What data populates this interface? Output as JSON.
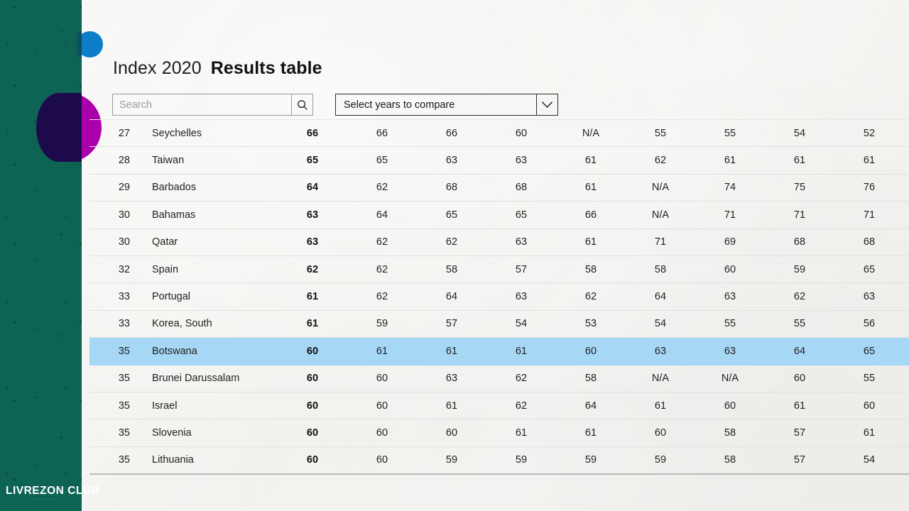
{
  "brand": {
    "logo_text": "LIVREZON CLUB",
    "logo_subtitle": "··························",
    "sidebar_color": "#0d6354",
    "circle_blue": "#0d7ec9",
    "circle_magenta": "#aa00ab",
    "circle_dark": "#1c0a4c"
  },
  "header": {
    "index_label": "Index 2020",
    "title": "Results table"
  },
  "search": {
    "value": "",
    "placeholder": "Search",
    "icon": "search-icon"
  },
  "year_select": {
    "label": "Select years to compare",
    "icon": "chevron-down-icon"
  },
  "table": {
    "highlight_color": "#a6d7f5",
    "highlighted_row_name": "Botswana",
    "rows": [
      {
        "rank": "27",
        "country": "Seychelles",
        "score": "66",
        "years": [
          "66",
          "66",
          "60",
          "N/A",
          "55",
          "55",
          "54",
          "52"
        ],
        "highlight": false
      },
      {
        "rank": "28",
        "country": "Taiwan",
        "score": "65",
        "years": [
          "65",
          "63",
          "63",
          "61",
          "62",
          "61",
          "61",
          "61"
        ],
        "highlight": false
      },
      {
        "rank": "29",
        "country": "Barbados",
        "score": "64",
        "years": [
          "62",
          "68",
          "68",
          "61",
          "N/A",
          "74",
          "75",
          "76"
        ],
        "highlight": false
      },
      {
        "rank": "30",
        "country": "Bahamas",
        "score": "63",
        "years": [
          "64",
          "65",
          "65",
          "66",
          "N/A",
          "71",
          "71",
          "71"
        ],
        "highlight": false
      },
      {
        "rank": "30",
        "country": "Qatar",
        "score": "63",
        "years": [
          "62",
          "62",
          "63",
          "61",
          "71",
          "69",
          "68",
          "68"
        ],
        "highlight": false
      },
      {
        "rank": "32",
        "country": "Spain",
        "score": "62",
        "years": [
          "62",
          "58",
          "57",
          "58",
          "58",
          "60",
          "59",
          "65"
        ],
        "highlight": false
      },
      {
        "rank": "33",
        "country": "Portugal",
        "score": "61",
        "years": [
          "62",
          "64",
          "63",
          "62",
          "64",
          "63",
          "62",
          "63"
        ],
        "highlight": false
      },
      {
        "rank": "33",
        "country": "Korea, South",
        "score": "61",
        "years": [
          "59",
          "57",
          "54",
          "53",
          "54",
          "55",
          "55",
          "56"
        ],
        "highlight": false
      },
      {
        "rank": "35",
        "country": "Botswana",
        "score": "60",
        "years": [
          "61",
          "61",
          "61",
          "60",
          "63",
          "63",
          "64",
          "65"
        ],
        "highlight": true
      },
      {
        "rank": "35",
        "country": "Brunei Darussalam",
        "score": "60",
        "years": [
          "60",
          "63",
          "62",
          "58",
          "N/A",
          "N/A",
          "60",
          "55"
        ],
        "highlight": false
      },
      {
        "rank": "35",
        "country": "Israel",
        "score": "60",
        "years": [
          "60",
          "61",
          "62",
          "64",
          "61",
          "60",
          "61",
          "60"
        ],
        "highlight": false
      },
      {
        "rank": "35",
        "country": "Slovenia",
        "score": "60",
        "years": [
          "60",
          "60",
          "61",
          "61",
          "60",
          "58",
          "57",
          "61"
        ],
        "highlight": false
      },
      {
        "rank": "35",
        "country": "Lithuania",
        "score": "60",
        "years": [
          "60",
          "59",
          "59",
          "59",
          "59",
          "58",
          "57",
          "54"
        ],
        "highlight": false
      }
    ]
  }
}
